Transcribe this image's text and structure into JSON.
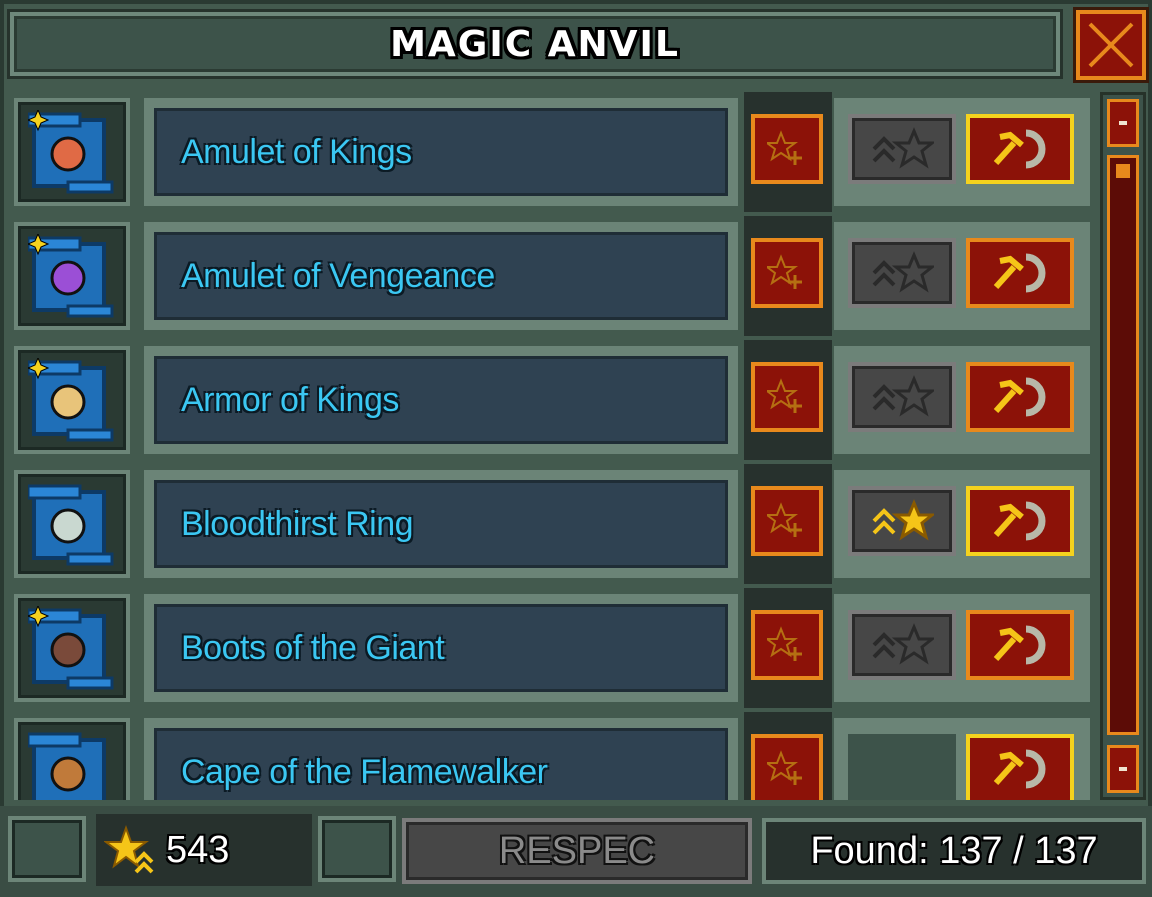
{
  "window": {
    "title": "MAGIC ANVIL",
    "close_icon": "close-x-icon"
  },
  "items": [
    {
      "name": "Amulet of Kings",
      "icon": "amulet-scroll-icon",
      "new": true,
      "item_color": "#e06a45",
      "stars_state": "locked",
      "stars_icon": "stars-outline-icon"
    },
    {
      "name": "Amulet of Vengeance",
      "icon": "amulet-scroll-icon",
      "new": true,
      "item_color": "#9b4fd6",
      "stars_state": "locked",
      "stars_icon": "stars-outline-icon"
    },
    {
      "name": "Armor of Kings",
      "icon": "armor-scroll-icon",
      "new": true,
      "item_color": "#e8c47a",
      "stars_state": "locked",
      "stars_icon": "stars-outline-icon"
    },
    {
      "name": "Bloodthirst Ring",
      "icon": "ring-scroll-icon",
      "new": false,
      "item_color": "#c9d8d0",
      "stars_state": "earned",
      "stars_icon": "stars-gold-icon"
    },
    {
      "name": "Boots of the Giant",
      "icon": "boots-scroll-icon",
      "new": true,
      "item_color": "#7a4a3a",
      "stars_state": "locked",
      "stars_icon": "stars-outline-icon"
    },
    {
      "name": "Cape of the Flamewalker",
      "icon": "cape-scroll-icon",
      "new": false,
      "item_color": "#c07a3a",
      "stars_state": "none",
      "stars_icon": ""
    }
  ],
  "footer": {
    "points": "543",
    "points_icon": "star-points-icon",
    "respec_label": "RESPEC",
    "found_label": "Found: 137 / 137"
  },
  "colors": {
    "item_name": "#3bc7f2",
    "button_red": "#8c1208",
    "button_border": "#e8891c",
    "gold": "#f5c518"
  }
}
